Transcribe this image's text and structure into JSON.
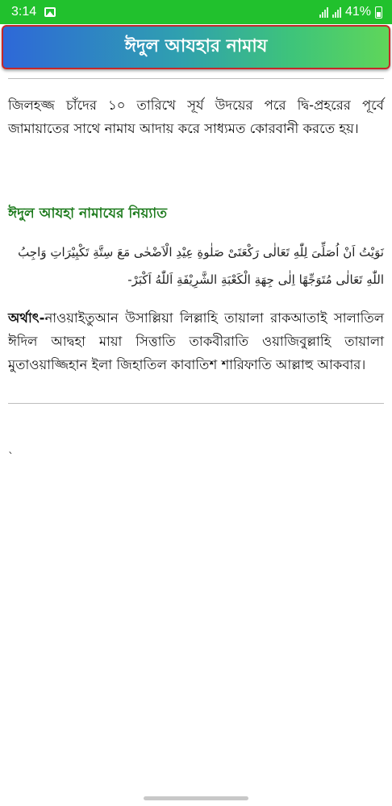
{
  "status_bar": {
    "time": "3:14",
    "battery": "41%",
    "icons": [
      "image-icon",
      "signal-icon",
      "signal-icon",
      "battery-charging-icon"
    ]
  },
  "app_bar": {
    "title": "ঈদুল আযহার নামায",
    "colors": {
      "border": "#c62828",
      "gradient_start": "#2e68d8",
      "gradient_end": "#5fd65a"
    }
  },
  "content": {
    "intro": "জিলহজ্জ চাঁদের ১০ তারিখে সূর্য উদয়ের পরে দ্বি-প্রহরের পূর্বে জামায়াতের সাথে নামায আদায় করে সাধ্যমত কোরবানী করতে হয়।",
    "niyyat_heading": "ঈদুল আযহা নামাযের নিয়্যাত",
    "niyyat_heading_color": "#1c7a1c",
    "arabic_text": "نَوَيْتُ اَنْ اُصَلِّىَ لِلّٰهِ تَعَالٰى رَكْعَتَىْ صَلٰوةِ عِيْدِ الْاَضْحٰى مَعَ سِتَّةِ تَكْبِيْرَاتِ وَاجِبُ اللّٰهِ تَعَالٰى مُتَوَجِّهًا اِلٰى جِهَةِ الْكَعْبَةِ الشَّرِيْفَةِ اَللّٰهُ اَكْبَرْ-",
    "meaning_label": "অর্থাৎ-",
    "meaning_text": "নাওয়াইতুআন উসাল্লিয়া লিল্লাহি তায়ালা রাকআতাই সালাতিল ঈদিল আদ্বহা মায়া সিত্তাতি তাকবীরাতি ওয়াজিবুল্লাহি তায়ালা মুতাওয়াজ্জিহান ইলা জিহাতিল কাবাতিশ শারিফাতি আল্লাহু আকবার।",
    "stray_mark": "`"
  }
}
